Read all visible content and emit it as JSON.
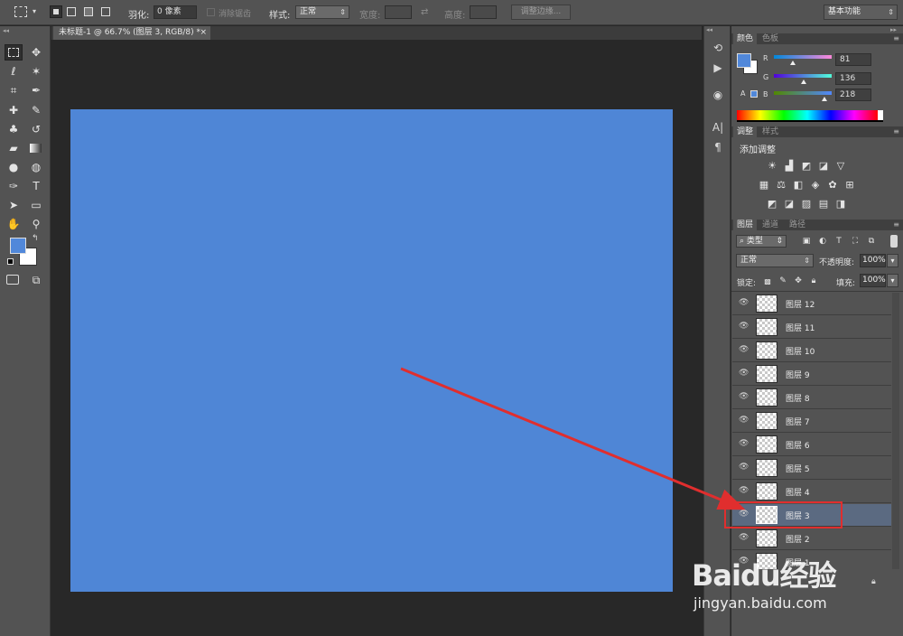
{
  "optbar": {
    "feather_label": "羽化:",
    "feather_value": "0 像素",
    "antialias_label": "消除锯齿",
    "style_label": "样式:",
    "style_value": "正常",
    "width_label": "宽度:",
    "height_label": "高度:",
    "refine_edge": "调整边缘...",
    "workspace": "基本功能"
  },
  "document": {
    "tab_title": "未标题-1 @ 66.7% (图层 3, RGB/8) *",
    "tab_close": "×",
    "canvas_color": "#4f86d6"
  },
  "color_panel": {
    "tab_active": "颜色",
    "tab_other": "色板",
    "menu": "≡",
    "r_label": "R",
    "g_label": "G",
    "b_label": "B",
    "r": "81",
    "g": "136",
    "b": "218",
    "fg_color": "#5188da"
  },
  "adjust_panel": {
    "tab_active": "调整",
    "tab_other": "样式",
    "menu": "≡",
    "title": "添加调整"
  },
  "layers_panel": {
    "tabs": [
      "图层",
      "通道",
      "路径"
    ],
    "menu": "≡",
    "filter_type": "类型",
    "blend_mode": "正常",
    "opacity_label": "不透明度:",
    "opacity_value": "100%",
    "lock_label": "锁定:",
    "fill_label": "填充:",
    "fill_value": "100%",
    "layers": [
      {
        "name": "图层 12",
        "selected": false
      },
      {
        "name": "图层 11",
        "selected": false
      },
      {
        "name": "图层 10",
        "selected": false
      },
      {
        "name": "图层 9",
        "selected": false
      },
      {
        "name": "图层 8",
        "selected": false
      },
      {
        "name": "图层 7",
        "selected": false
      },
      {
        "name": "图层 6",
        "selected": false
      },
      {
        "name": "图层 5",
        "selected": false
      },
      {
        "name": "图层 4",
        "selected": false
      },
      {
        "name": "图层 3",
        "selected": true
      },
      {
        "name": "图层 2",
        "selected": false
      },
      {
        "name": "图层 1",
        "selected": false
      }
    ]
  },
  "watermark": {
    "logo": "Baidu经验",
    "url": "jingyan.baidu.com"
  },
  "colors": {
    "annotation_red": "#e02e2e"
  }
}
